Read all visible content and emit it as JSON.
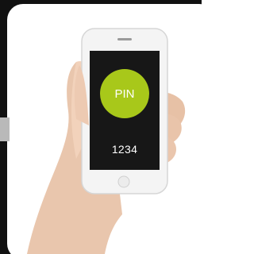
{
  "screen": {
    "badge_label": "PIN",
    "pin_code": "1234"
  },
  "colors": {
    "badge": "#a8c81a",
    "screen": "#171717",
    "background": "#111111"
  },
  "icons": [
    "hand-icon",
    "smartphone-icon",
    "pin-badge-icon"
  ]
}
